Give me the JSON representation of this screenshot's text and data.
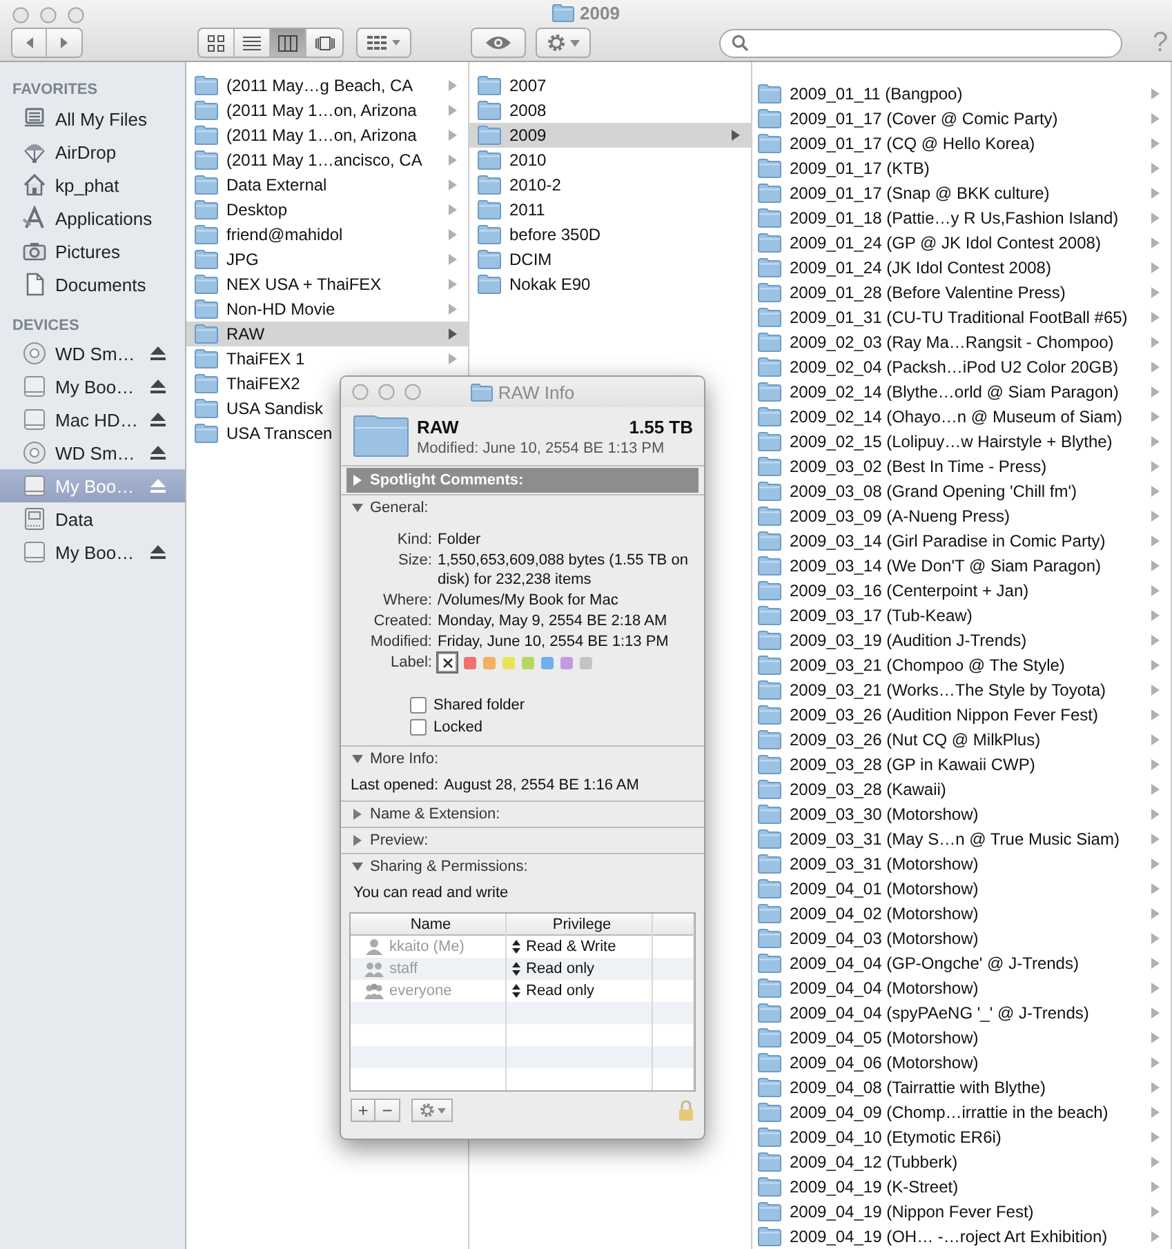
{
  "window": {
    "title": "2009"
  },
  "toolbar": {
    "view_modes": [
      {
        "kind": "icons",
        "selected": false
      },
      {
        "kind": "list",
        "selected": false
      },
      {
        "kind": "columns",
        "selected": true
      },
      {
        "kind": "coverflow",
        "selected": false
      }
    ],
    "help": "?"
  },
  "sidebar": {
    "sections": [
      {
        "heading": "FAVORITES",
        "items": [
          {
            "label": "All My Files",
            "kind": "all-files",
            "selected": false,
            "eject": false
          },
          {
            "label": "AirDrop",
            "kind": "airdrop",
            "selected": false,
            "eject": false
          },
          {
            "label": "kp_phat",
            "kind": "home",
            "selected": false,
            "eject": false
          },
          {
            "label": "Applications",
            "kind": "applications",
            "selected": false,
            "eject": false
          },
          {
            "label": "Pictures",
            "kind": "pictures",
            "selected": false,
            "eject": false
          },
          {
            "label": "Documents",
            "kind": "documents",
            "selected": false,
            "eject": false
          }
        ]
      },
      {
        "heading": "DEVICES",
        "items": [
          {
            "label": "WD Sm…",
            "kind": "disc",
            "selected": false,
            "eject": true
          },
          {
            "label": "My Boo…",
            "kind": "drive",
            "selected": false,
            "eject": true
          },
          {
            "label": "Mac HD…",
            "kind": "drive",
            "selected": false,
            "eject": true
          },
          {
            "label": "WD Sm…",
            "kind": "disc",
            "selected": false,
            "eject": true
          },
          {
            "label": "My Boo…",
            "kind": "drive",
            "selected": true,
            "eject": true
          },
          {
            "label": "Data",
            "kind": "external",
            "selected": false,
            "eject": false
          },
          {
            "label": "My Boo…",
            "kind": "drive",
            "selected": false,
            "eject": true
          }
        ]
      }
    ]
  },
  "columns": [
    {
      "items": [
        {
          "name": "(2011 May…g Beach, CA",
          "selected": false,
          "has_children": true
        },
        {
          "name": "(2011 May 1…on, Arizona",
          "selected": false,
          "has_children": true
        },
        {
          "name": "(2011 May 1…on, Arizona",
          "selected": false,
          "has_children": true
        },
        {
          "name": "(2011 May 1…ancisco, CA",
          "selected": false,
          "has_children": true
        },
        {
          "name": "Data External",
          "selected": false,
          "has_children": true
        },
        {
          "name": "Desktop",
          "selected": false,
          "has_children": true
        },
        {
          "name": "friend@mahidol",
          "selected": false,
          "has_children": true
        },
        {
          "name": "JPG",
          "selected": false,
          "has_children": true
        },
        {
          "name": "NEX USA + ThaiFEX",
          "selected": false,
          "has_children": true
        },
        {
          "name": "Non-HD Movie",
          "selected": false,
          "has_children": true
        },
        {
          "name": "RAW",
          "selected": true,
          "has_children": true
        },
        {
          "name": "ThaiFEX 1",
          "selected": false,
          "has_children": true
        },
        {
          "name": "ThaiFEX2",
          "selected": false,
          "has_children": false
        },
        {
          "name": "USA Sandisk",
          "selected": false,
          "has_children": false
        },
        {
          "name": "USA Transcen",
          "selected": false,
          "has_children": false
        }
      ]
    },
    {
      "items": [
        {
          "name": "2007",
          "selected": false,
          "has_children": false
        },
        {
          "name": "2008",
          "selected": false,
          "has_children": false
        },
        {
          "name": "2009",
          "selected": true,
          "has_children": true
        },
        {
          "name": "2010",
          "selected": false,
          "has_children": false
        },
        {
          "name": "2010-2",
          "selected": false,
          "has_children": false
        },
        {
          "name": "2011",
          "selected": false,
          "has_children": false
        },
        {
          "name": "before 350D",
          "selected": false,
          "has_children": false
        },
        {
          "name": "DCIM",
          "selected": false,
          "has_children": false
        },
        {
          "name": "Nokak E90",
          "selected": false,
          "has_children": false
        }
      ]
    },
    {
      "items": [
        {
          "name": "2009_01_11 (Bangpoo)",
          "selected": false,
          "has_children": true
        },
        {
          "name": "2009_01_17 (Cover @ Comic Party)",
          "selected": false,
          "has_children": true
        },
        {
          "name": "2009_01_17 (CQ @ Hello Korea)",
          "selected": false,
          "has_children": true
        },
        {
          "name": "2009_01_17 (KTB)",
          "selected": false,
          "has_children": true
        },
        {
          "name": "2009_01_17 (Snap @ BKK culture)",
          "selected": false,
          "has_children": true
        },
        {
          "name": "2009_01_18 (Pattie…y R Us,Fashion Island)",
          "selected": false,
          "has_children": true
        },
        {
          "name": "2009_01_24 (GP @ JK Idol Contest 2008)",
          "selected": false,
          "has_children": true
        },
        {
          "name": "2009_01_24 (JK Idol Contest 2008)",
          "selected": false,
          "has_children": true
        },
        {
          "name": "2009_01_28 (Before Valentine Press)",
          "selected": false,
          "has_children": true
        },
        {
          "name": "2009_01_31 (CU-TU Traditional FootBall #65)",
          "selected": false,
          "has_children": true
        },
        {
          "name": "2009_02_03 (Ray Ma…Rangsit - Chompoo)",
          "selected": false,
          "has_children": true
        },
        {
          "name": "2009_02_04 (Packsh…iPod U2 Color 20GB)",
          "selected": false,
          "has_children": true
        },
        {
          "name": "2009_02_14 (Blythe…orld @ Siam Paragon)",
          "selected": false,
          "has_children": true
        },
        {
          "name": "2009_02_14 (Ohayo…n @ Museum of Siam)",
          "selected": false,
          "has_children": true
        },
        {
          "name": "2009_02_15 (Lolipuy…w Hairstyle + Blythe)",
          "selected": false,
          "has_children": true
        },
        {
          "name": "2009_03_02 (Best In Time - Press)",
          "selected": false,
          "has_children": true
        },
        {
          "name": "2009_03_08 (Grand Opening 'Chill fm')",
          "selected": false,
          "has_children": true
        },
        {
          "name": "2009_03_09 (A-Nueng Press)",
          "selected": false,
          "has_children": true
        },
        {
          "name": "2009_03_14 (Girl Paradise in Comic Party)",
          "selected": false,
          "has_children": true
        },
        {
          "name": "2009_03_14 (We Don'T @ Siam Paragon)",
          "selected": false,
          "has_children": true
        },
        {
          "name": "2009_03_16 (Centerpoint + Jan)",
          "selected": false,
          "has_children": true
        },
        {
          "name": "2009_03_17 (Tub-Keaw)",
          "selected": false,
          "has_children": true
        },
        {
          "name": "2009_03_19 (Audition J-Trends)",
          "selected": false,
          "has_children": true
        },
        {
          "name": "2009_03_21 (Chompoo @ The Style)",
          "selected": false,
          "has_children": true
        },
        {
          "name": "2009_03_21 (Works…The Style by Toyota)",
          "selected": false,
          "has_children": true
        },
        {
          "name": "2009_03_26 (Audition Nippon Fever Fest)",
          "selected": false,
          "has_children": true
        },
        {
          "name": "2009_03_26 (Nut CQ @ MilkPlus)",
          "selected": false,
          "has_children": true
        },
        {
          "name": "2009_03_28 (GP in Kawaii CWP)",
          "selected": false,
          "has_children": true
        },
        {
          "name": "2009_03_28 (Kawaii)",
          "selected": false,
          "has_children": true
        },
        {
          "name": "2009_03_30 (Motorshow)",
          "selected": false,
          "has_children": true
        },
        {
          "name": "2009_03_31 (May S…n @ True Music Siam)",
          "selected": false,
          "has_children": true
        },
        {
          "name": "2009_03_31 (Motorshow)",
          "selected": false,
          "has_children": true
        },
        {
          "name": "2009_04_01 (Motorshow)",
          "selected": false,
          "has_children": true
        },
        {
          "name": "2009_04_02 (Motorshow)",
          "selected": false,
          "has_children": true
        },
        {
          "name": "2009_04_03 (Motorshow)",
          "selected": false,
          "has_children": true
        },
        {
          "name": "2009_04_04 (GP-Ongche' @ J-Trends)",
          "selected": false,
          "has_children": true
        },
        {
          "name": "2009_04_04 (Motorshow)",
          "selected": false,
          "has_children": true
        },
        {
          "name": "2009_04_04 (spyPAeNG '_' @ J-Trends)",
          "selected": false,
          "has_children": true
        },
        {
          "name": "2009_04_05 (Motorshow)",
          "selected": false,
          "has_children": true
        },
        {
          "name": "2009_04_06 (Motorshow)",
          "selected": false,
          "has_children": true
        },
        {
          "name": "2009_04_08 (Tairrattie with Blythe)",
          "selected": false,
          "has_children": true
        },
        {
          "name": "2009_04_09 (Chomp…irrattie in the beach)",
          "selected": false,
          "has_children": true
        },
        {
          "name": "2009_04_10 (Etymotic ER6i)",
          "selected": false,
          "has_children": true
        },
        {
          "name": "2009_04_12 (Tubberk)",
          "selected": false,
          "has_children": true
        },
        {
          "name": "2009_04_19 (K-Street)",
          "selected": false,
          "has_children": true
        },
        {
          "name": "2009_04_19 (Nippon Fever Fest)",
          "selected": false,
          "has_children": true
        },
        {
          "name": "2009_04_19 (OH… -…roject Art Exhibition)",
          "selected": false,
          "has_children": true
        }
      ]
    }
  ],
  "info_window": {
    "title": "RAW Info",
    "name": "RAW",
    "size": "1.55 TB",
    "modified": "Modified: June 10, 2554 BE 1:13 PM",
    "sections": [
      {
        "kind": "spotlight",
        "title": "Spotlight Comments:",
        "expanded": false,
        "selected": true
      },
      {
        "kind": "general",
        "title": "General:",
        "expanded": true,
        "selected": false,
        "fields": [
          {
            "label": "Kind:",
            "value": "Folder"
          },
          {
            "label": "Size:",
            "value": "1,550,653,609,088 bytes (1.55 TB on disk) for 232,238 items"
          },
          {
            "label": "Where:",
            "value": "/Volumes/My Book for Mac"
          },
          {
            "label": "Created:",
            "value": "Monday, May 9, 2554 BE 2:18 AM"
          },
          {
            "label": "Modified:",
            "value": "Friday, June 10, 2554 BE 1:13 PM"
          }
        ],
        "label_caption": "Label:",
        "labels": [
          {
            "kind": "none",
            "selected": true
          },
          {
            "kind": "color",
            "color": "#f07070",
            "selected": false
          },
          {
            "kind": "color",
            "color": "#f3b060",
            "selected": false
          },
          {
            "kind": "color",
            "color": "#e8e45a",
            "selected": false
          },
          {
            "kind": "color",
            "color": "#b4d862",
            "selected": false
          },
          {
            "kind": "color",
            "color": "#70aef0",
            "selected": false
          },
          {
            "kind": "color",
            "color": "#c69ae0",
            "selected": false
          },
          {
            "kind": "color",
            "color": "#c4c4c4",
            "selected": false
          }
        ],
        "checkboxes": [
          {
            "label": "Shared folder",
            "checked": false
          },
          {
            "label": "Locked",
            "checked": false
          }
        ]
      },
      {
        "kind": "more_info",
        "title": "More Info:",
        "expanded": true,
        "selected": false,
        "fields": [
          {
            "label": "Last opened:",
            "value": "August 28, 2554 BE 1:16 AM"
          }
        ]
      },
      {
        "kind": "name_extension",
        "title": "Name & Extension:",
        "expanded": false,
        "selected": false
      },
      {
        "kind": "preview",
        "title": "Preview:",
        "expanded": false,
        "selected": false
      },
      {
        "kind": "sharing",
        "title": "Sharing & Permissions:",
        "expanded": true,
        "selected": false,
        "note": "You can read and write",
        "columns": [
          "Name",
          "Privilege"
        ],
        "rows": [
          {
            "name": "kkaito (Me)",
            "kind": "user",
            "privilege": "Read & Write"
          },
          {
            "name": "staff",
            "kind": "group",
            "privilege": "Read only"
          },
          {
            "name": "everyone",
            "kind": "everyone",
            "privilege": "Read only"
          }
        ],
        "buttons": [
          "+",
          "−"
        ]
      }
    ]
  }
}
